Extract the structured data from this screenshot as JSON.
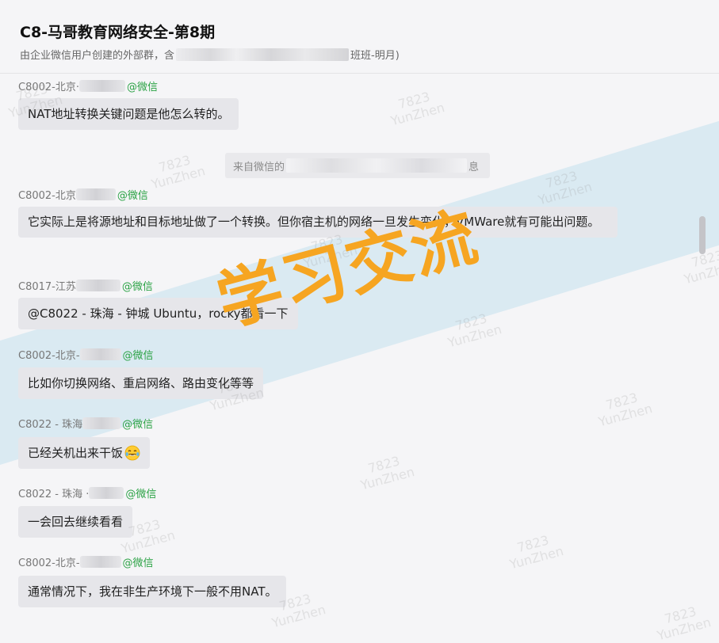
{
  "header": {
    "title": "C8-马哥教育网络安全-第8期",
    "subtitle_prefix": "由企业微信用户创建的外部群，含",
    "subtitle_suffix": "班班-明月)"
  },
  "system_message": {
    "prefix": "来自微信的",
    "suffix": "息"
  },
  "messages": [
    {
      "sender": "C8002-北京·",
      "tag": "@微信",
      "text": "NAT地址转换关键问题是他怎么转的。"
    },
    {
      "sender": "C8002-北京",
      "tag": "@微信",
      "text": "它实际上是将源地址和目标地址做了一个转换。但你宿主机的网络一旦发生变化，VMWare就有可能出问题。"
    },
    {
      "sender": "C8017-江苏",
      "tag": "@微信",
      "text": "@C8022 - 珠海 - 钟城 Ubuntu，rocky都看一下"
    },
    {
      "sender": "C8002-北京-",
      "tag": "@微信",
      "text": "比如你切换网络、重启网络、路由变化等等"
    },
    {
      "sender": "C8022 - 珠海",
      "tag": "@微信",
      "text": "已经关机出来干饭",
      "emoji": "laughing-tears-emoji"
    },
    {
      "sender": "C8022 - 珠海 ·",
      "tag": "@微信",
      "text": "一会回去继续看看"
    },
    {
      "sender": "C8002-北京-",
      "tag": "@微信",
      "text": "通常情况下，我在非生产环境下一般不用NAT。"
    }
  ],
  "watermark": {
    "main_text": "学习交流",
    "stamp_line1": "7823",
    "stamp_line2": "YunZhen",
    "main_color": "#f6a521",
    "band_color": "#d0e6f0"
  },
  "colors": {
    "background": "#f5f5f7",
    "bubble": "#e6e6ea",
    "wechat_tag": "#2ba245"
  }
}
